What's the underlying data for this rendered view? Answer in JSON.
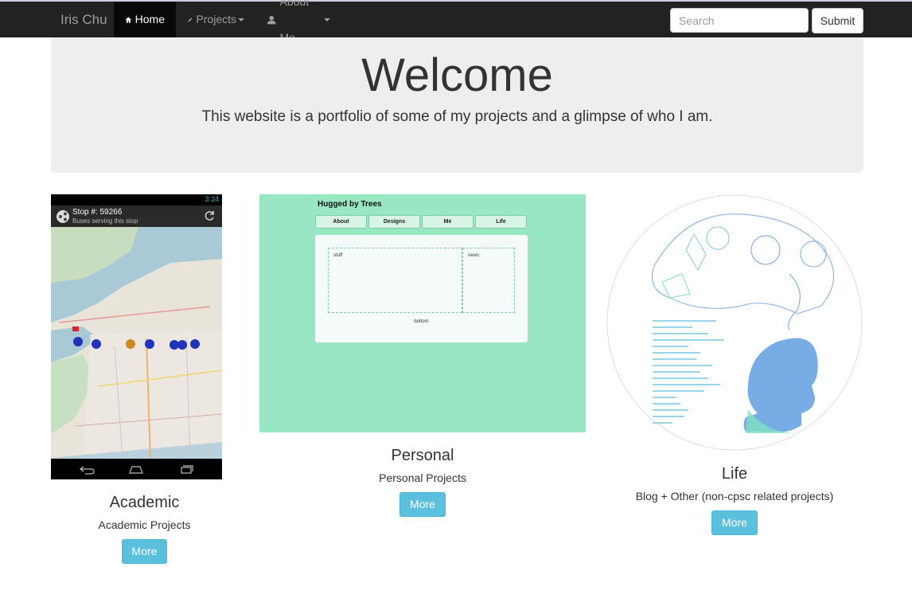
{
  "nav": {
    "brand": "Iris Chu",
    "home": "Home",
    "projects": "Projects",
    "about": "About Me",
    "search_placeholder": "Search",
    "submit": "Submit"
  },
  "jumbotron": {
    "title": "Welcome",
    "subtitle": "This website is a portfolio of some of my projects and a glimpse of who I am."
  },
  "cards": [
    {
      "title": "Academic",
      "desc": "Academic Projects",
      "button": "More",
      "screenshot": {
        "clock": "3:24",
        "stop_title": "Stop #: 59266",
        "stop_subtitle": "Buses serving this stop"
      }
    },
    {
      "title": "Personal",
      "desc": "Personal Projects",
      "button": "More",
      "screenshot": {
        "site_title": "Hugged by Trees",
        "tabs": [
          "About",
          "Designs",
          "Me",
          "Life"
        ],
        "box1": "stuff",
        "box2": "news",
        "footer": "bottom"
      }
    },
    {
      "title": "Life",
      "desc": "Blog + Other (non-cpsc related projects)",
      "button": "More"
    }
  ]
}
